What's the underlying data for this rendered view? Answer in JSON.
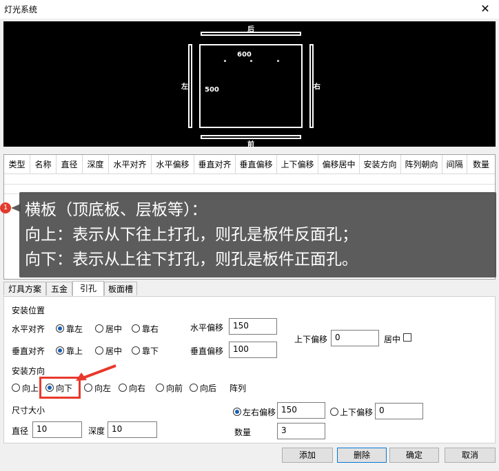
{
  "window": {
    "title": "灯光系统",
    "close_glyph": "✕"
  },
  "preview": {
    "label_back": "后",
    "label_front": "前",
    "label_left": "左",
    "label_right": "右",
    "width_value": "600",
    "height_value": "500"
  },
  "grid": {
    "columns": [
      "类型",
      "名称",
      "直径",
      "深度",
      "水平对齐",
      "水平偏移",
      "垂直对齐",
      "垂直偏移",
      "上下偏移",
      "偏移居中",
      "安装方向",
      "阵列朝向",
      "间隔",
      "数量"
    ]
  },
  "tooltip": {
    "badge": "1",
    "lines": [
      "横板（顶底板、层板等）：",
      "向上：表示从下往上打孔，则孔是板件反面孔；",
      "向下：表示从上往下打孔，则孔是板件正面孔。"
    ]
  },
  "tabs": [
    {
      "label": "灯具方案",
      "active": false
    },
    {
      "label": "五金",
      "active": false
    },
    {
      "label": "引孔",
      "active": true
    },
    {
      "label": "板面槽",
      "active": false
    }
  ],
  "form": {
    "install_position": "安装位置",
    "h_align_label": "水平对齐",
    "h_align_options": [
      "靠左",
      "居中",
      "靠右"
    ],
    "h_offset_label": "水平偏移",
    "h_offset_value": "150",
    "v_align_label": "垂直对齐",
    "v_align_options": [
      "靠上",
      "居中",
      "靠下"
    ],
    "v_offset_label": "垂直偏移",
    "v_offset_value": "100",
    "ud_offset_label": "上下偏移",
    "ud_offset_value": "0",
    "center_label": "居中",
    "install_direction": "安装方向",
    "directions": [
      "向上",
      "向下",
      "向左",
      "向右",
      "向前",
      "向后"
    ],
    "array_label": "阵列",
    "size_label": "尺寸大小",
    "diameter_label": "直径",
    "diameter_value": "10",
    "depth_label": "深度",
    "depth_value": "10",
    "lr_offset_label": "左右偏移",
    "lr_offset_value": "150",
    "ud_offset2_label": "上下偏移",
    "ud_offset2_value": "0",
    "count_label": "数量",
    "count_value": "3"
  },
  "buttons": {
    "add": "添加",
    "delete": "删除",
    "ok": "确定",
    "cancel": "取消"
  }
}
